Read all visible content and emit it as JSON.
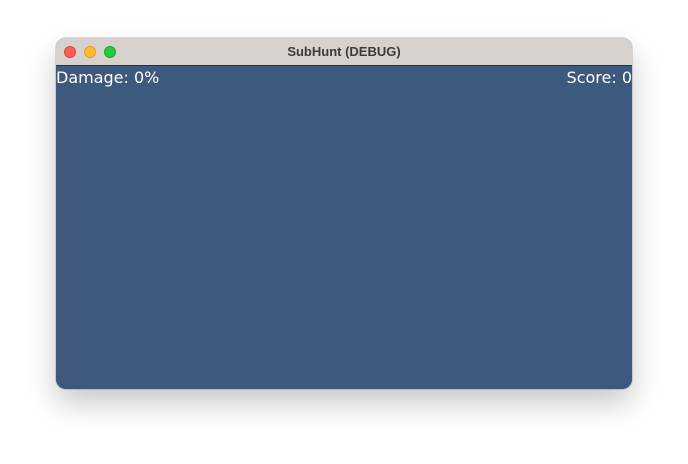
{
  "window": {
    "title": "SubHunt (DEBUG)"
  },
  "hud": {
    "damage_text": "Damage: 0%",
    "score_text": "Score: 0"
  },
  "colors": {
    "game_background": "#3d5a7e",
    "titlebar": "#d6d1cc",
    "hud_text": "#ffffff"
  }
}
